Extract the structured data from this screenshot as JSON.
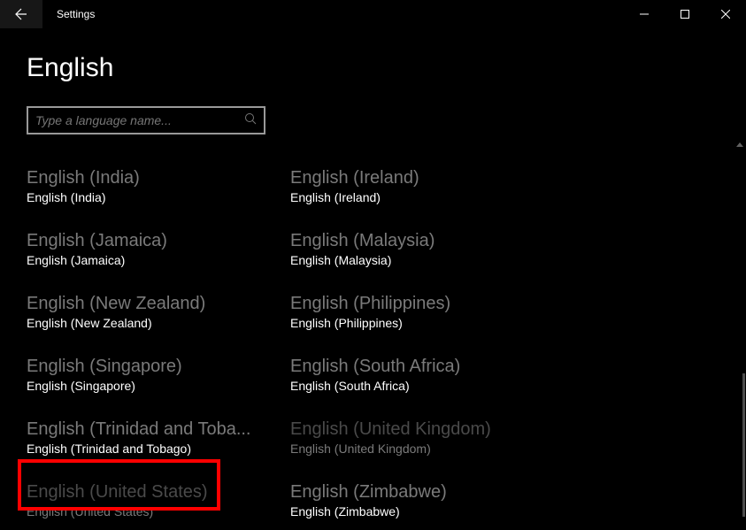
{
  "titlebar": {
    "title": "Settings"
  },
  "page": {
    "heading": "English"
  },
  "search": {
    "placeholder": "Type a language name...",
    "value": ""
  },
  "languages": [
    {
      "primary": "English (India)",
      "secondary": "English (India)",
      "dimmed": false
    },
    {
      "primary": "English (Ireland)",
      "secondary": "English (Ireland)",
      "dimmed": false
    },
    {
      "primary": "English (Jamaica)",
      "secondary": "English (Jamaica)",
      "dimmed": false
    },
    {
      "primary": "English (Malaysia)",
      "secondary": "English (Malaysia)",
      "dimmed": false
    },
    {
      "primary": "English (New Zealand)",
      "secondary": "English (New Zealand)",
      "dimmed": false
    },
    {
      "primary": "English (Philippines)",
      "secondary": "English (Philippines)",
      "dimmed": false
    },
    {
      "primary": "English (Singapore)",
      "secondary": "English (Singapore)",
      "dimmed": false
    },
    {
      "primary": "English (South Africa)",
      "secondary": "English (South Africa)",
      "dimmed": false
    },
    {
      "primary": "English (Trinidad and Toba...",
      "secondary": "English (Trinidad and Tobago)",
      "dimmed": false
    },
    {
      "primary": "English (United Kingdom)",
      "secondary": "English (United Kingdom)",
      "dimmed": true
    },
    {
      "primary": "English (United States)",
      "secondary": "English (United States)",
      "dimmed": true
    },
    {
      "primary": "English (Zimbabwe)",
      "secondary": "English (Zimbabwe)",
      "dimmed": false
    }
  ],
  "highlighted_index": 10
}
